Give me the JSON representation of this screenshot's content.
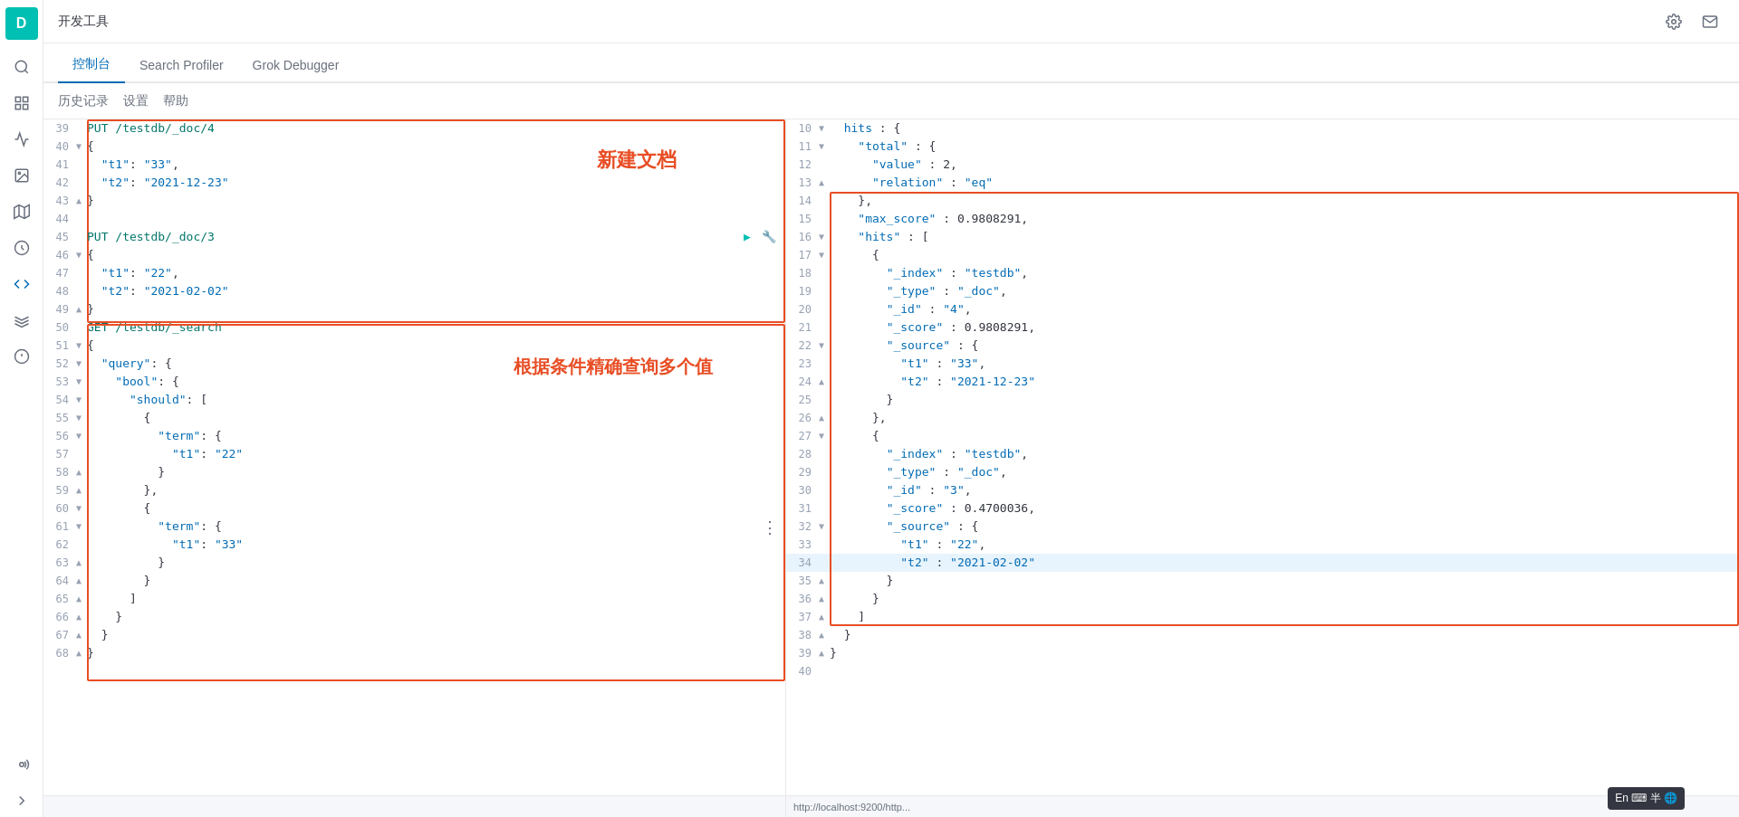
{
  "app": {
    "logo_letter": "D",
    "title": "开发工具"
  },
  "tabs": [
    {
      "label": "控制台",
      "active": true
    },
    {
      "label": "Search Profiler",
      "active": false
    },
    {
      "label": "Grok Debugger",
      "active": false
    }
  ],
  "subtoolbar": [
    {
      "label": "历史记录"
    },
    {
      "label": "设置"
    },
    {
      "label": "帮助"
    }
  ],
  "left_code": {
    "lines": [
      {
        "num": "39",
        "fold": "",
        "content": "PUT /testdb/_doc/4",
        "type": "method",
        "selected": false
      },
      {
        "num": "40",
        "fold": "▼",
        "content": "{",
        "type": "normal",
        "selected": false
      },
      {
        "num": "41",
        "fold": "",
        "content": "  \"t1\": \"33\",",
        "type": "kv",
        "selected": false
      },
      {
        "num": "42",
        "fold": "",
        "content": "  \"t2\": \"2021-12-23\"",
        "type": "kv",
        "selected": false
      },
      {
        "num": "43",
        "fold": "▲",
        "content": "}",
        "type": "normal",
        "selected": false
      },
      {
        "num": "44",
        "fold": "",
        "content": "",
        "type": "normal",
        "selected": false
      },
      {
        "num": "45",
        "fold": "",
        "content": "PUT /testdb/_doc/3",
        "type": "method",
        "selected": false,
        "has_actions": true
      },
      {
        "num": "46",
        "fold": "▼",
        "content": "{",
        "type": "normal",
        "selected": false
      },
      {
        "num": "47",
        "fold": "",
        "content": "  \"t1\": \"22\",",
        "type": "kv",
        "selected": false
      },
      {
        "num": "48",
        "fold": "",
        "content": "  \"t2\": \"2021-02-02\"",
        "type": "kv",
        "selected": false
      },
      {
        "num": "49",
        "fold": "▲",
        "content": "}",
        "type": "normal",
        "selected": false
      },
      {
        "num": "50",
        "fold": "",
        "content": "GET /testdb/_search",
        "type": "method",
        "selected": false
      },
      {
        "num": "51",
        "fold": "▼",
        "content": "{",
        "type": "normal",
        "selected": false
      },
      {
        "num": "52",
        "fold": "▼",
        "content": "  \"query\": {",
        "type": "normal",
        "selected": false
      },
      {
        "num": "53",
        "fold": "▼",
        "content": "    \"bool\": {",
        "type": "normal",
        "selected": false
      },
      {
        "num": "54",
        "fold": "▼",
        "content": "      \"should\": [",
        "type": "normal",
        "selected": false
      },
      {
        "num": "55",
        "fold": "▼",
        "content": "        {",
        "type": "normal",
        "selected": false
      },
      {
        "num": "56",
        "fold": "▼",
        "content": "          \"term\": {",
        "type": "normal",
        "selected": false
      },
      {
        "num": "57",
        "fold": "",
        "content": "            \"t1\": \"22\"",
        "type": "kv",
        "selected": false
      },
      {
        "num": "58",
        "fold": "▲",
        "content": "          }",
        "type": "normal",
        "selected": false
      },
      {
        "num": "59",
        "fold": "▲",
        "content": "        },",
        "type": "normal",
        "selected": false
      },
      {
        "num": "60",
        "fold": "▼",
        "content": "        {",
        "type": "normal",
        "selected": false
      },
      {
        "num": "61",
        "fold": "▼",
        "content": "          \"term\": {",
        "type": "normal",
        "selected": false
      },
      {
        "num": "62",
        "fold": "",
        "content": "            \"t1\": \"33\"",
        "type": "kv",
        "selected": false
      },
      {
        "num": "63",
        "fold": "▲",
        "content": "          }",
        "type": "normal",
        "selected": false
      },
      {
        "num": "64",
        "fold": "▲",
        "content": "        }",
        "type": "normal",
        "selected": false
      },
      {
        "num": "65",
        "fold": "▲",
        "content": "      ]",
        "type": "normal",
        "selected": false
      },
      {
        "num": "66",
        "fold": "▲",
        "content": "    }",
        "type": "normal",
        "selected": false
      },
      {
        "num": "67",
        "fold": "▲",
        "content": "  }",
        "type": "normal",
        "selected": false
      },
      {
        "num": "68",
        "fold": "▲",
        "content": "}",
        "type": "normal",
        "selected": false
      }
    ],
    "label_top": "新建文档",
    "label_bottom": "根据条件精确查询多个值"
  },
  "right_code": {
    "lines": [
      {
        "num": "10",
        "fold": "▼",
        "content": "  hits : {",
        "selected": false
      },
      {
        "num": "11",
        "fold": "▼",
        "content": "    \"total\" : {",
        "selected": false
      },
      {
        "num": "12",
        "fold": "",
        "content": "      \"value\" : 2,",
        "selected": false
      },
      {
        "num": "13",
        "fold": "▲",
        "content": "      \"relation\" : \"eq\"",
        "selected": false
      },
      {
        "num": "14",
        "fold": "",
        "content": "    },",
        "selected": false
      },
      {
        "num": "15",
        "fold": "",
        "content": "    \"max_score\" : 0.9808291,",
        "selected": false
      },
      {
        "num": "16",
        "fold": "▼",
        "content": "    \"hits\" : [",
        "selected": false
      },
      {
        "num": "17",
        "fold": "▼",
        "content": "      {",
        "selected": false
      },
      {
        "num": "18",
        "fold": "",
        "content": "        \"_index\" : \"testdb\",",
        "selected": false
      },
      {
        "num": "19",
        "fold": "",
        "content": "        \"_type\" : \"_doc\",",
        "selected": false
      },
      {
        "num": "20",
        "fold": "",
        "content": "        \"_id\" : \"4\",",
        "selected": false
      },
      {
        "num": "21",
        "fold": "",
        "content": "        \"_score\" : 0.9808291,",
        "selected": false
      },
      {
        "num": "22",
        "fold": "▼",
        "content": "        \"_source\" : {",
        "selected": false
      },
      {
        "num": "23",
        "fold": "",
        "content": "          \"t1\" : \"33\",",
        "selected": false
      },
      {
        "num": "24",
        "fold": "▲",
        "content": "          \"t2\" : \"2021-12-23\"",
        "selected": false
      },
      {
        "num": "25",
        "fold": "",
        "content": "        }",
        "selected": false
      },
      {
        "num": "26",
        "fold": "▲",
        "content": "      },",
        "selected": false
      },
      {
        "num": "27",
        "fold": "▼",
        "content": "      {",
        "selected": false
      },
      {
        "num": "28",
        "fold": "",
        "content": "        \"_index\" : \"testdb\",",
        "selected": false
      },
      {
        "num": "29",
        "fold": "",
        "content": "        \"_type\" : \"_doc\",",
        "selected": false
      },
      {
        "num": "30",
        "fold": "",
        "content": "        \"_id\" : \"3\",",
        "selected": false
      },
      {
        "num": "31",
        "fold": "",
        "content": "        \"_score\" : 0.4700036,",
        "selected": false
      },
      {
        "num": "32",
        "fold": "▼",
        "content": "        \"_source\" : {",
        "selected": false
      },
      {
        "num": "33",
        "fold": "",
        "content": "          \"t1\" : \"22\",",
        "selected": false
      },
      {
        "num": "34",
        "fold": "",
        "content": "          \"t2\" : \"2021-02-02\"",
        "selected": true
      },
      {
        "num": "35",
        "fold": "▲",
        "content": "        }",
        "selected": false
      },
      {
        "num": "36",
        "fold": "▲",
        "content": "      }",
        "selected": false
      },
      {
        "num": "37",
        "fold": "▲",
        "content": "    ]",
        "selected": false
      },
      {
        "num": "38",
        "fold": "▲",
        "content": "  }",
        "selected": false
      },
      {
        "num": "39",
        "fold": "▲",
        "content": "}",
        "selected": false
      },
      {
        "num": "40",
        "fold": "",
        "content": "",
        "selected": false
      }
    ]
  },
  "ime": {
    "label": "En ⌨ 半 🌐"
  },
  "bottom_bar": {
    "url": "http://localhost:9200/http..."
  }
}
